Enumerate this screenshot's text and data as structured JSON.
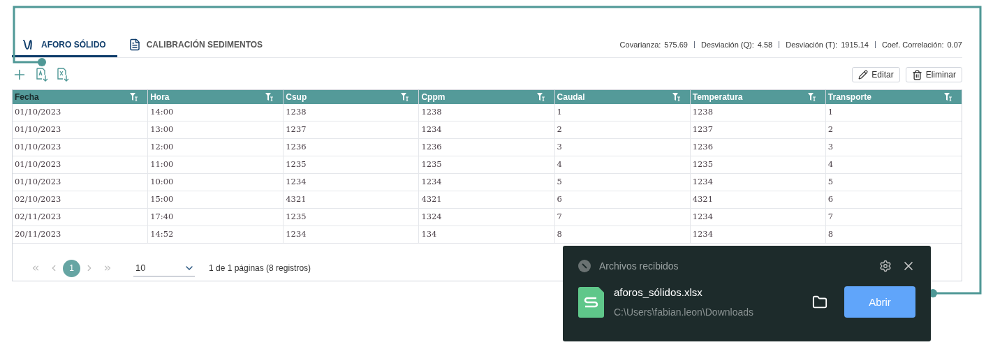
{
  "tabs": [
    {
      "label": "AFORO SÓLIDO",
      "selected": true,
      "kind": "wave"
    },
    {
      "label": "CALIBRACIÓN SEDIMENTOS",
      "selected": false,
      "kind": "doc"
    }
  ],
  "stats": [
    {
      "label": "Covarianza:",
      "value": "575.69"
    },
    {
      "label": "Desviación (Q):",
      "value": "4.58"
    },
    {
      "label": "Desviación (T):",
      "value": "1915.14"
    },
    {
      "label": "Coef. Correlación:",
      "value": "0.07"
    }
  ],
  "actions": [
    {
      "label": "Editar",
      "kind": "edit"
    },
    {
      "label": "Eliminar",
      "kind": "delete"
    }
  ],
  "table": {
    "columns": [
      {
        "label": "Fecha",
        "selected": true
      },
      {
        "label": "Hora",
        "selected": false
      },
      {
        "label": "Csup",
        "selected": false
      },
      {
        "label": "Cppm",
        "selected": false
      },
      {
        "label": "Caudal",
        "selected": false
      },
      {
        "label": "Temperatura",
        "selected": false
      },
      {
        "label": "Transporte",
        "selected": false
      }
    ],
    "rows": [
      [
        "01/10/2023",
        "14:00",
        "1238",
        "1238",
        "1",
        "1238",
        "1"
      ],
      [
        "01/10/2023",
        "13:00",
        "1237",
        "1234",
        "2",
        "1237",
        "2"
      ],
      [
        "01/10/2023",
        "12:00",
        "1236",
        "1236",
        "3",
        "1236",
        "3"
      ],
      [
        "01/10/2023",
        "11:00",
        "1235",
        "1235",
        "4",
        "1235",
        "4"
      ],
      [
        "01/10/2023",
        "10:00",
        "1234",
        "1234",
        "5",
        "1234",
        "5"
      ],
      [
        "02/10/2023",
        "15:00",
        "4321",
        "4321",
        "6",
        "4321",
        "6"
      ],
      [
        "02/11/2023",
        "17:40",
        "1235",
        "1324",
        "7",
        "1234",
        "7"
      ],
      [
        "20/11/2023",
        "14:52",
        "1234",
        "134",
        "8",
        "1234",
        "8"
      ]
    ]
  },
  "pagination": {
    "pages": [
      {
        "label": "1",
        "selected": true
      }
    ],
    "page_size": "10",
    "summary": "1 de 1 páginas (8 registros)"
  },
  "download_popup": {
    "title": "Archivos recibidos",
    "file_name": "aforos_sólidos.xlsx",
    "path": "C:\\Users\\fabian.leon\\Downloads",
    "button": "Abrir"
  }
}
